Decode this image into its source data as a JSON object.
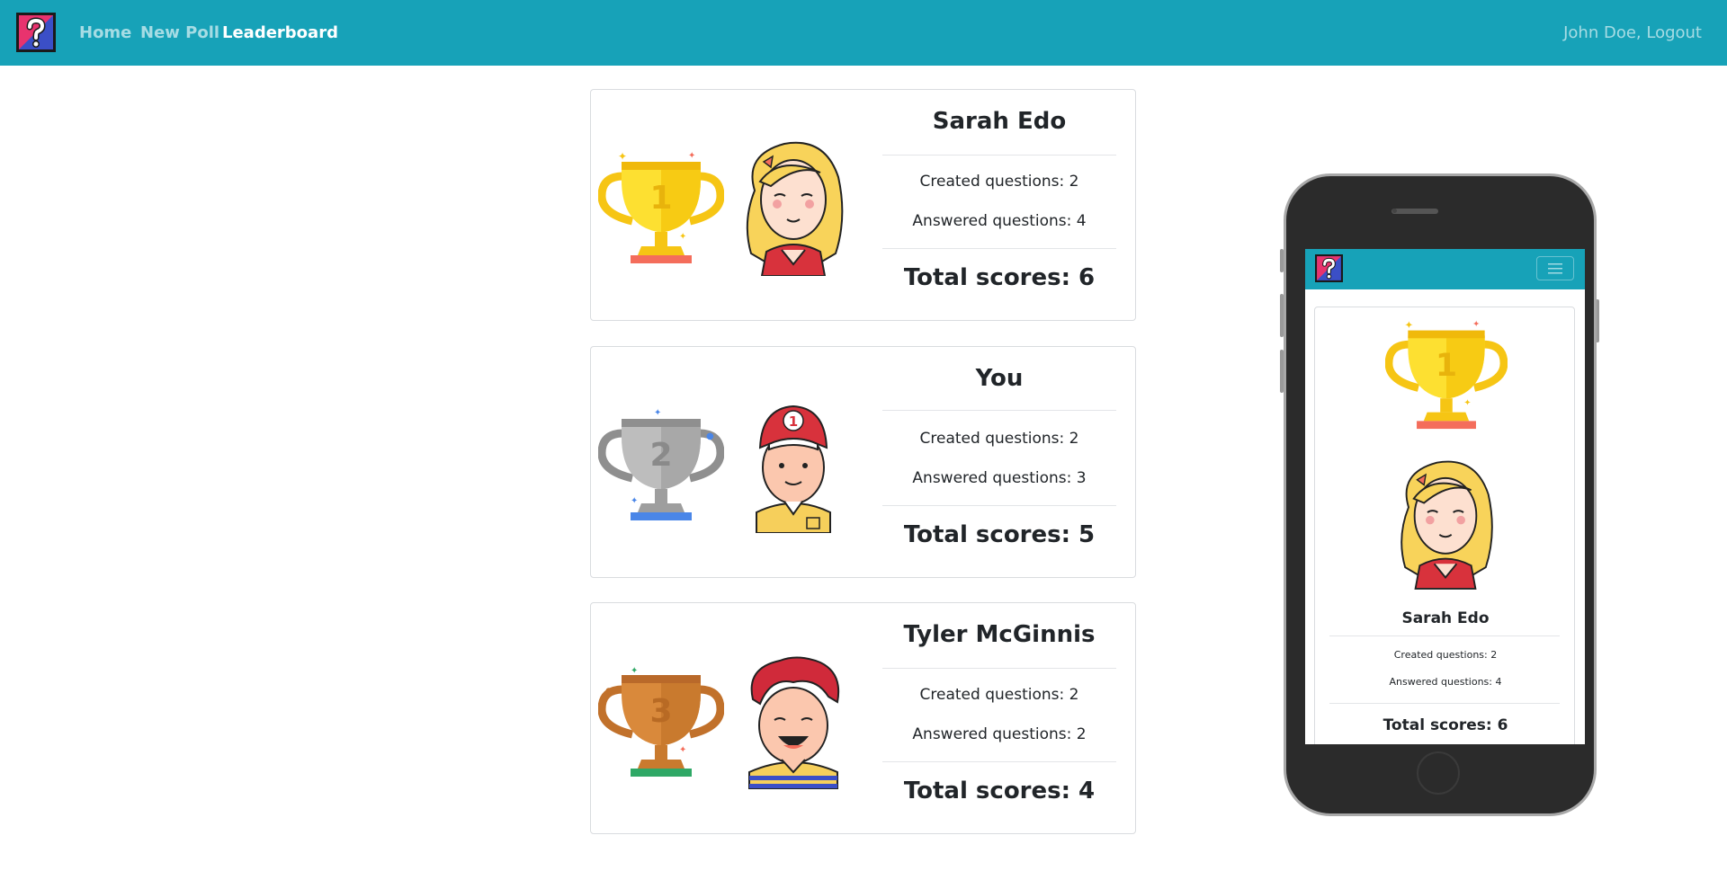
{
  "navbar": {
    "links": [
      {
        "label": "Home"
      },
      {
        "label": "New Poll"
      },
      {
        "label": "Leaderboard"
      }
    ],
    "user_text": "John Doe, Logout",
    "brand_color": "#17a2b8"
  },
  "leaderboard": [
    {
      "rank": "1",
      "name": "Sarah Edo",
      "created": "Created questions: 2",
      "answered": "Answered questions: 4",
      "total": "Total scores: 6",
      "trophy_icon": "gold-trophy-icon",
      "avatar": "girl-avatar"
    },
    {
      "rank": "2",
      "name": "You",
      "created": "Created questions: 2",
      "answered": "Answered questions: 3",
      "total": "Total scores: 5",
      "trophy_icon": "silver-trophy-icon",
      "avatar": "boy-cap-avatar"
    },
    {
      "rank": "3",
      "name": "Tyler McGinnis",
      "created": "Created questions: 2",
      "answered": "Answered questions: 2",
      "total": "Total scores: 4",
      "trophy_icon": "bronze-trophy-icon",
      "avatar": "boy-redhair-avatar"
    }
  ],
  "phone_preview": {
    "rank": "1",
    "name": "Sarah Edo",
    "created": "Created questions: 2",
    "answered": "Answered questions: 4",
    "total": "Total scores: 6"
  }
}
